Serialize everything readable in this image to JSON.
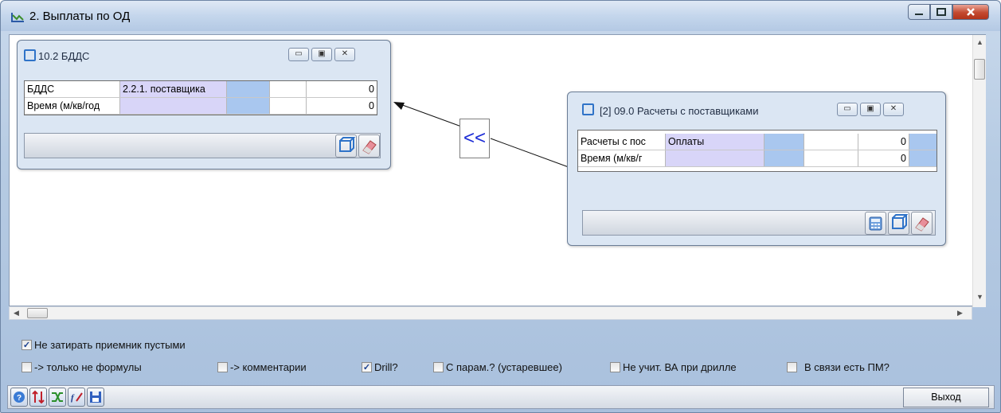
{
  "window": {
    "title": "2. Выплаты по ОД",
    "controls": [
      "minimize",
      "maximize",
      "close"
    ]
  },
  "subwindow_left": {
    "title": "10.2 БДДС",
    "rows": [
      {
        "label": "БДДС",
        "value": "2.2.1. поставщика",
        "amount": "0"
      },
      {
        "label": "Время (м/кв/год",
        "value": "",
        "amount": "0"
      }
    ]
  },
  "subwindow_right": {
    "title": "[2] 09.0 Расчеты с поставщиками",
    "rows": [
      {
        "label": "Расчеты с пос",
        "value": "Оплаты",
        "amount": "0"
      },
      {
        "label": "Время (м/кв/г",
        "value": "",
        "amount": "0"
      }
    ]
  },
  "link_button": "<<",
  "options": {
    "no_overwrite": {
      "label": "Не затирать приемник пустыми",
      "checked": true
    },
    "only_non_formulas": {
      "label": "-> только не формулы",
      "checked": false
    },
    "comments": {
      "label": "-> комментарии",
      "checked": false
    },
    "drill": {
      "label": "Drill?",
      "checked": true
    },
    "with_params": {
      "label": "С парам.? (устаревшее)",
      "checked": false
    },
    "ignore_va": {
      "label": "Не учит. ВА при дрилле",
      "checked": false
    },
    "has_pm": {
      "label": "В связи есть ПМ?",
      "checked": false
    }
  },
  "statusbar": {
    "exit_label": "Выход",
    "tools": [
      "help-icon",
      "sort-icon",
      "shuffle-icon",
      "formula-icon",
      "save-icon"
    ]
  },
  "colors": {
    "lavender_cell": "#d8d5f8",
    "blue_cell": "#a9c7ef",
    "link_arrow": "#1b2bd6"
  }
}
